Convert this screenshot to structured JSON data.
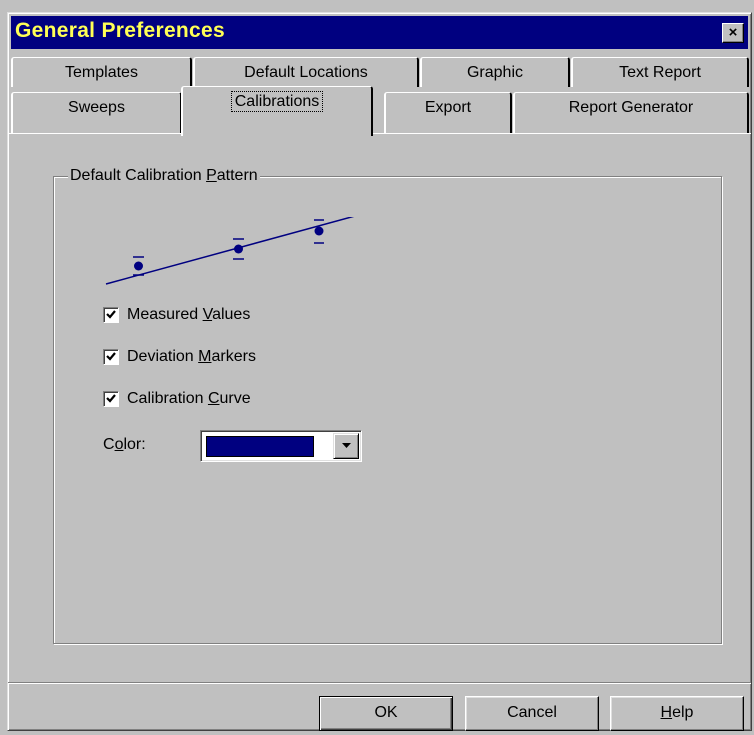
{
  "window": {
    "title": "General Preferences",
    "close_symbol": "×"
  },
  "tabs": {
    "back_row": [
      "Templates",
      "Default Locations",
      "Graphic",
      "Text Report"
    ],
    "front_row": [
      "Sweeps",
      "Calibrations",
      "Export",
      "Report Generator"
    ],
    "active": "Calibrations"
  },
  "group": {
    "label_prefix": "Default Calibration ",
    "label_mnemonic": "P",
    "label_suffix": "attern"
  },
  "checkboxes": [
    {
      "pre": "Measured ",
      "mnemonic": "V",
      "post": "alues",
      "checked": true
    },
    {
      "pre": "Deviation ",
      "mnemonic": "M",
      "post": "arkers",
      "checked": true
    },
    {
      "pre": "Calibration ",
      "mnemonic": "C",
      "post": "urve",
      "checked": true
    }
  ],
  "color_field": {
    "pre": "C",
    "mnemonic": "o",
    "post": "lor:",
    "value": "#000080"
  },
  "buttons": {
    "ok": "OK",
    "cancel": "Cancel",
    "help_mnemonic": "H",
    "help_rest": "elp"
  },
  "colors": {
    "title_bar": "#000080",
    "title_text": "#FFFF55",
    "face": "#C0C0C0",
    "calibration_pattern": "#000080"
  },
  "icons": [
    "close-icon",
    "checkmark-icon",
    "dropdown-arrow-icon"
  ]
}
